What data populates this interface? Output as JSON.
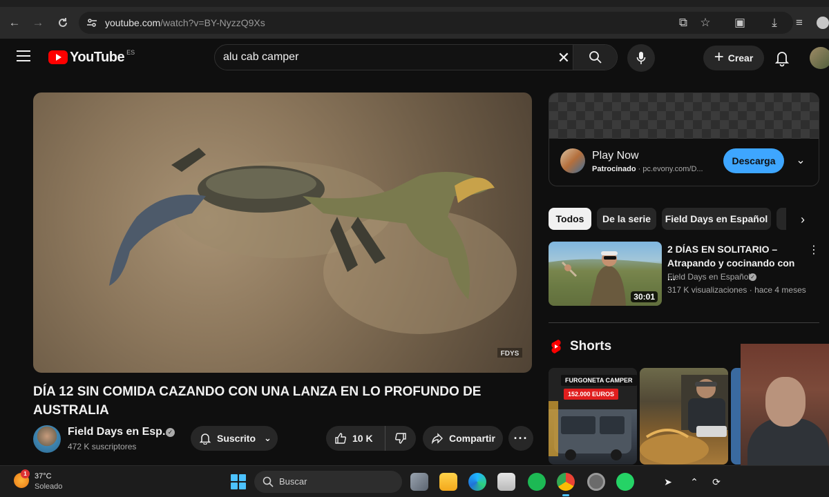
{
  "browser": {
    "url_host": "youtube.com",
    "url_path": "/watch?v=BY-NyzzQ9Xs"
  },
  "youtube": {
    "logo_text": "YouTube",
    "country_code": "ES",
    "search_value": "alu cab camper",
    "create_label": "Crear"
  },
  "video": {
    "title": "DÍA 12 SIN COMIDA CAZANDO CON UNA LANZA EN LO PROFUNDO DE AUSTRALIA",
    "channel": "Field Days en Esp...",
    "subscribers": "472 K suscriptores",
    "subscribe_label": "Suscrito",
    "likes": "10 K",
    "share_label": "Compartir",
    "watermark": "FDYS"
  },
  "ad": {
    "title": "Play Now",
    "sponsored": "Patrocinado",
    "domain": "· pc.evony.com/D...",
    "cta": "Descarga"
  },
  "chips": [
    "Todos",
    "De la serie",
    "Field Days en Español"
  ],
  "related": {
    "title": "2 DÍAS EN SOLITARIO – Atrapando y cocinando con ...",
    "channel": "Field Days en Español",
    "meta": "317 K visualizaciones · hace 4 meses",
    "duration": "30:01"
  },
  "shorts": {
    "heading": "Shorts",
    "badge_top": "FURGONETA CAMPER",
    "badge_price": "152.000 EUROS"
  },
  "taskbar": {
    "temperature": "37°C",
    "weather": "Soleado",
    "weather_badge": "1",
    "search_label": "Buscar"
  },
  "colors": {
    "background": "#0f0f0f",
    "accent_blue": "#3ea6ff",
    "youtube_red": "#ff0000"
  }
}
